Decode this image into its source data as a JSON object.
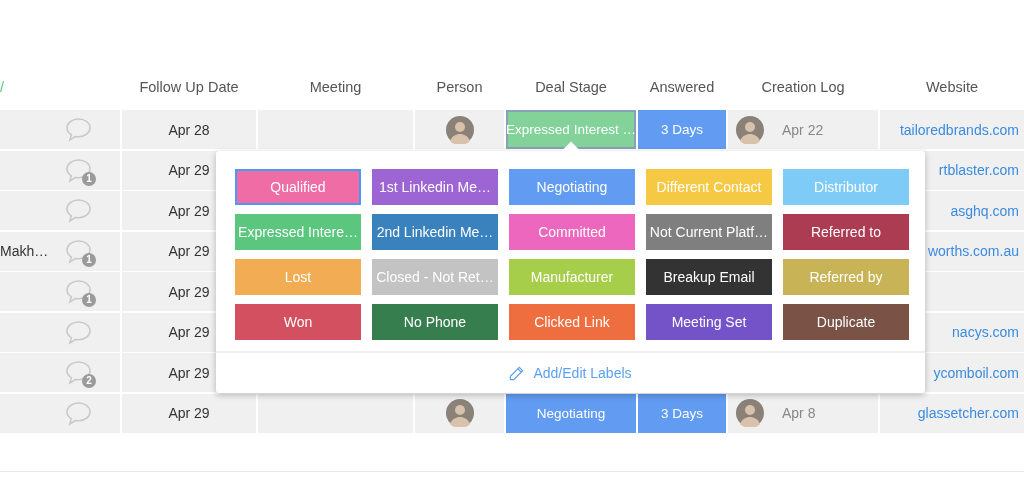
{
  "table": {
    "columns": [
      "/",
      "Follow Up Date",
      "Meeting",
      "Person",
      "Deal Stage",
      "Answered",
      "Creation Log",
      "Website"
    ],
    "rows": [
      {
        "follow_up": "Apr 28",
        "person": true,
        "deal_stage": {
          "text": "Expressed Interest …",
          "color": "#82d29a",
          "selected": true
        },
        "answered": {
          "text": "3 Days",
          "color": "#619cf2"
        },
        "creator": true,
        "created": "Apr 22",
        "website": "tailoredbrands.com"
      },
      {
        "comments": "1",
        "follow_up": "Apr 29",
        "website": "rtblaster.com"
      },
      {
        "follow_up": "Apr 29",
        "website": "asghq.com"
      },
      {
        "name": "Makh…",
        "comments": "1",
        "follow_up": "Apr 29",
        "website": "worths.com.au"
      },
      {
        "comments": "1",
        "follow_up": "Apr 29"
      },
      {
        "follow_up": "Apr 29",
        "website": "nacys.com"
      },
      {
        "comments": "2",
        "follow_up": "Apr 29",
        "website": "ycomboil.com"
      },
      {
        "follow_up": "Apr 29",
        "person": true,
        "deal_stage": {
          "text": "Negotiating",
          "color": "#619cf2",
          "selected": false
        },
        "answered": {
          "text": "3 Days",
          "color": "#619cf2"
        },
        "creator": true,
        "created": "Apr 8",
        "website": "glassetcher.com"
      }
    ]
  },
  "label_picker": {
    "labels": [
      {
        "text": "Qualified",
        "color": "#ef6ca4",
        "selected": true
      },
      {
        "text": "1st Linkedin Me…",
        "color": "#9d64d4",
        "selected": false
      },
      {
        "text": "Negotiating",
        "color": "#619cf2",
        "selected": false
      },
      {
        "text": "Different Contact",
        "color": "#f6c944",
        "selected": false
      },
      {
        "text": "Distributor",
        "color": "#7ecbf8",
        "selected": false
      },
      {
        "text": "Expressed Intere…",
        "color": "#5bc67d",
        "selected": false
      },
      {
        "text": "2nd Linkedin Me…",
        "color": "#3982be",
        "selected": false
      },
      {
        "text": "Committed",
        "color": "#ee67bf",
        "selected": false
      },
      {
        "text": "Not Current Platf…",
        "color": "#7f7f7f",
        "selected": false
      },
      {
        "text": "Referred to",
        "color": "#ab3c52",
        "selected": false
      },
      {
        "text": "Lost",
        "color": "#f2ac54",
        "selected": false
      },
      {
        "text": "Closed - Not Ret…",
        "color": "#c3c3c3",
        "selected": false
      },
      {
        "text": "Manufacturer",
        "color": "#a6ce4a",
        "selected": false
      },
      {
        "text": "Breakup Email",
        "color": "#333333",
        "selected": false
      },
      {
        "text": "Referred by",
        "color": "#c8b456",
        "selected": false
      },
      {
        "text": "Won",
        "color": "#d2505f",
        "selected": false
      },
      {
        "text": "No Phone",
        "color": "#377e4f",
        "selected": false
      },
      {
        "text": "Clicked Link",
        "color": "#ee6e40",
        "selected": false
      },
      {
        "text": "Meeting Set",
        "color": "#7452c8",
        "selected": false
      },
      {
        "text": "Duplicate",
        "color": "#7a5246",
        "selected": false
      }
    ],
    "footer_link": "Add/Edit Labels"
  }
}
